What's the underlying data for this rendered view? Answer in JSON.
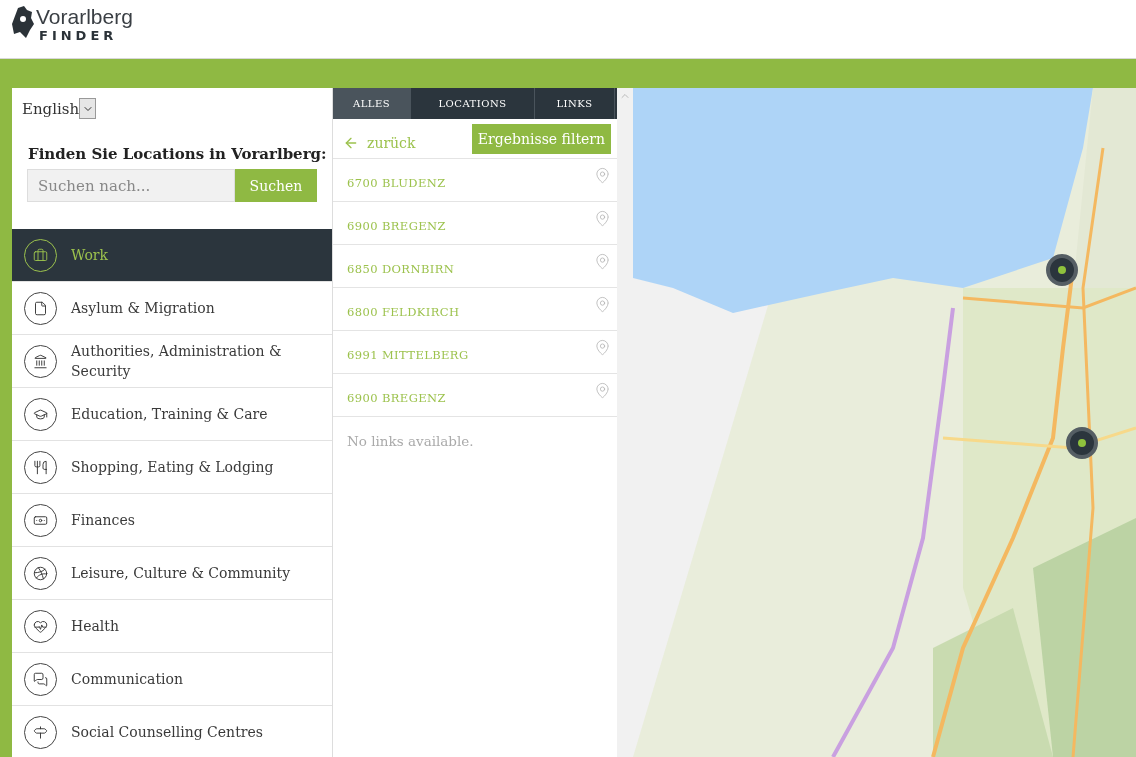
{
  "logo": {
    "title": "Vorarlberg",
    "subtitle": "FINDER"
  },
  "language": {
    "value": "English"
  },
  "search": {
    "heading": "Finden Sie Locations in Vorarlberg:",
    "placeholder": "Suchen nach...",
    "button": "Suchen"
  },
  "categories": [
    {
      "label": "Work",
      "selected": true
    },
    {
      "label": "Asylum & Migration",
      "selected": false
    },
    {
      "label": "Authorities, Administration & Security",
      "selected": false
    },
    {
      "label": "Education, Training & Care",
      "selected": false
    },
    {
      "label": "Shopping, Eating & Lodging",
      "selected": false
    },
    {
      "label": "Finances",
      "selected": false
    },
    {
      "label": "Leisure, Culture & Community",
      "selected": false
    },
    {
      "label": "Health",
      "selected": false
    },
    {
      "label": "Communication",
      "selected": false
    },
    {
      "label": "Social Counselling Centres",
      "selected": false
    }
  ],
  "tabs": [
    {
      "label": "ALLES",
      "selected": true
    },
    {
      "label": "LOCATIONS",
      "selected": false
    },
    {
      "label": "LINKS",
      "selected": false
    }
  ],
  "back_link": "zurück",
  "filter_button": "Ergebnisse filtern",
  "locations": [
    "6700 BLUDENZ",
    "6900 BREGENZ",
    "6850 DORNBIRN",
    "6800 FELDKIRCH",
    "6991 MITTELBERG",
    "6900 BREGENZ"
  ],
  "links_message": "No links available."
}
